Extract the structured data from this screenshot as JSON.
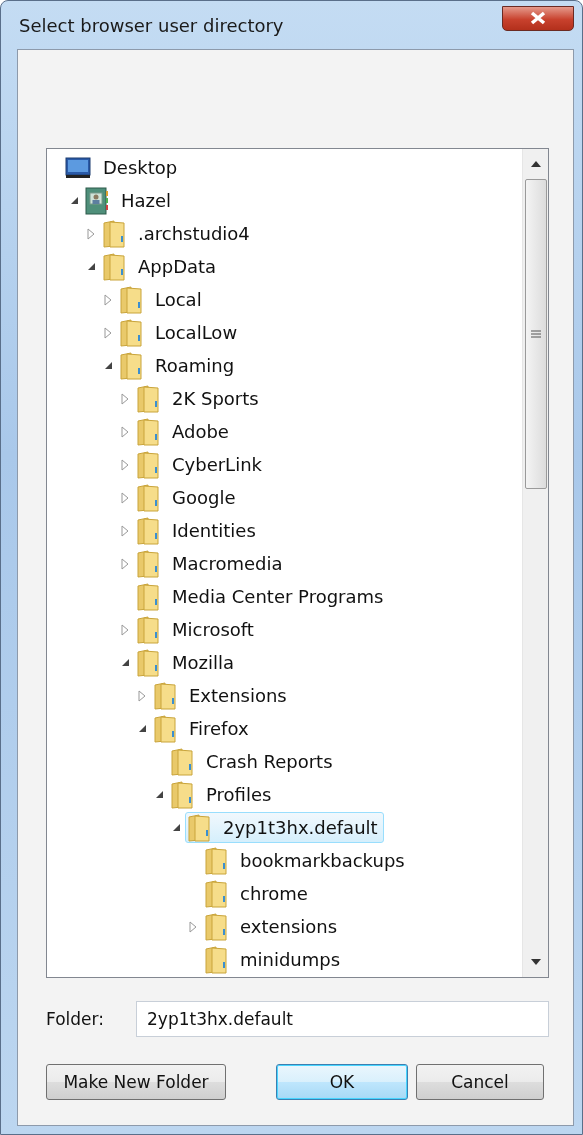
{
  "window": {
    "title": "Select browser user directory"
  },
  "tree": [
    {
      "label": "Desktop",
      "kind": "desktop",
      "selected": false
    },
    {
      "label": "Hazel",
      "kind": "user",
      "expandable": true,
      "expanded": true,
      "selected": false,
      "children": [
        {
          "label": ".archstudio4",
          "kind": "folder",
          "expandable": true,
          "expanded": false,
          "selected": false
        },
        {
          "label": "AppData",
          "kind": "folder",
          "expandable": true,
          "expanded": true,
          "selected": false,
          "children": [
            {
              "label": "Local",
              "kind": "folder",
              "expandable": true,
              "expanded": false,
              "selected": false
            },
            {
              "label": "LocalLow",
              "kind": "folder",
              "expandable": true,
              "expanded": false,
              "selected": false
            },
            {
              "label": "Roaming",
              "kind": "folder",
              "expandable": true,
              "expanded": true,
              "selected": false,
              "children": [
                {
                  "label": "2K Sports",
                  "kind": "folder",
                  "expandable": true,
                  "expanded": false,
                  "selected": false
                },
                {
                  "label": "Adobe",
                  "kind": "folder",
                  "expandable": true,
                  "expanded": false,
                  "selected": false
                },
                {
                  "label": "CyberLink",
                  "kind": "folder",
                  "expandable": true,
                  "expanded": false,
                  "selected": false
                },
                {
                  "label": "Google",
                  "kind": "folder",
                  "expandable": true,
                  "expanded": false,
                  "selected": false
                },
                {
                  "label": "Identities",
                  "kind": "folder",
                  "expandable": true,
                  "expanded": false,
                  "selected": false
                },
                {
                  "label": "Macromedia",
                  "kind": "folder",
                  "expandable": true,
                  "expanded": false,
                  "selected": false
                },
                {
                  "label": "Media Center Programs",
                  "kind": "folder",
                  "expandable": false,
                  "selected": false
                },
                {
                  "label": "Microsoft",
                  "kind": "folder",
                  "expandable": true,
                  "expanded": false,
                  "selected": false
                },
                {
                  "label": "Mozilla",
                  "kind": "folder",
                  "expandable": true,
                  "expanded": true,
                  "selected": false,
                  "children": [
                    {
                      "label": "Extensions",
                      "kind": "folder",
                      "expandable": true,
                      "expanded": false,
                      "selected": false
                    },
                    {
                      "label": "Firefox",
                      "kind": "folder",
                      "expandable": true,
                      "expanded": true,
                      "selected": false,
                      "children": [
                        {
                          "label": "Crash Reports",
                          "kind": "folder",
                          "expandable": false,
                          "selected": false
                        },
                        {
                          "label": "Profiles",
                          "kind": "folder",
                          "expandable": true,
                          "expanded": true,
                          "selected": false,
                          "children": [
                            {
                              "label": "2yp1t3hx.default",
                              "kind": "folder",
                              "expandable": true,
                              "expanded": true,
                              "selected": true,
                              "children": [
                                {
                                  "label": "bookmarkbackups",
                                  "kind": "folder",
                                  "expandable": false,
                                  "selected": false
                                },
                                {
                                  "label": "chrome",
                                  "kind": "folder",
                                  "expandable": false,
                                  "selected": false
                                },
                                {
                                  "label": "extensions",
                                  "kind": "folder",
                                  "expandable": true,
                                  "expanded": false,
                                  "selected": false
                                },
                                {
                                  "label": "minidumps",
                                  "kind": "folder",
                                  "expandable": false,
                                  "selected": false
                                }
                              ]
                            }
                          ]
                        }
                      ]
                    }
                  ]
                }
              ]
            }
          ]
        }
      ]
    }
  ],
  "folder_field": {
    "label": "Folder:",
    "value": "2yp1t3hx.default"
  },
  "buttons": [
    {
      "label": "Make New Folder",
      "default": false
    },
    {
      "label": "OK",
      "default": true
    },
    {
      "label": "Cancel",
      "default": false
    }
  ]
}
